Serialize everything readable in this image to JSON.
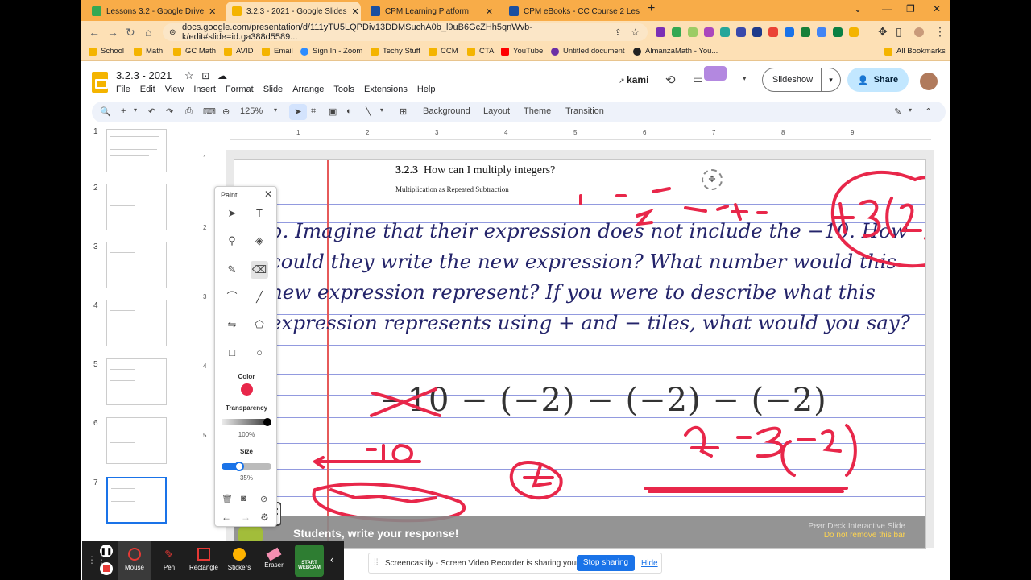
{
  "tabs": [
    {
      "title": "Lessons 3.2 - Google Drive",
      "color": "#34a853",
      "active": false
    },
    {
      "title": "3.2.3 - 2021 - Google Slides",
      "color": "#f4b400",
      "active": true
    },
    {
      "title": "CPM Learning Platform",
      "color": "#1a4fa0",
      "active": false
    },
    {
      "title": "CPM eBooks - CC Course 2 Less",
      "color": "#1a4fa0",
      "active": false
    }
  ],
  "address": "docs.google.com/presentation/d/111yTU5LQPDiv13DDMSuchA0b_l9uB6GcZHh5qnWvb-k/edit#slide=id.ga388d5589...",
  "bookmarks": [
    {
      "label": "School",
      "color": "#f4b400"
    },
    {
      "label": "Math",
      "color": "#f4b400"
    },
    {
      "label": "GC Math",
      "color": "#f4b400"
    },
    {
      "label": "AVID",
      "color": "#f4b400"
    },
    {
      "label": "Email",
      "color": "#f4b400"
    },
    {
      "label": "Sign In - Zoom",
      "color": "#2d8cff"
    },
    {
      "label": "Techy Stuff",
      "color": "#f4b400"
    },
    {
      "label": "CCM",
      "color": "#f4b400"
    },
    {
      "label": "CTA",
      "color": "#f4b400"
    },
    {
      "label": "YouTube",
      "color": "#ff0000"
    },
    {
      "label": "Untitled document",
      "color": "#6b2fa5"
    },
    {
      "label": "AlmanzaMath - You...",
      "color": "#222222"
    }
  ],
  "all_bookmarks": "All Bookmarks",
  "doc": {
    "title": "3.2.3 - 2021",
    "menu": [
      "File",
      "Edit",
      "View",
      "Insert",
      "Format",
      "Slide",
      "Arrange",
      "Tools",
      "Extensions",
      "Help"
    ],
    "kami": "kami",
    "slideshow": "Slideshow",
    "share": "Share"
  },
  "toolbar": {
    "zoom": "125%",
    "background": "Background",
    "layout": "Layout",
    "theme": "Theme",
    "transition": "Transition"
  },
  "ruler": [
    "1",
    "2",
    "3",
    "4",
    "5",
    "6",
    "7",
    "8",
    "9"
  ],
  "vruler": [
    "1",
    "2",
    "3",
    "4",
    "5"
  ],
  "thumbnails": [
    "1",
    "2",
    "3",
    "4",
    "5",
    "6",
    "7"
  ],
  "slide": {
    "heading_num": "3.2.3",
    "heading": "How can I multiply integers?",
    "subheading": "Multiplication as Repeated Subtraction",
    "question": "b.   Imagine that their expression does not include the −10.  How could they write the new expression?  What number would this new expression represent?  If you were to describe what this expression represents using + and − tiles, what would you say?",
    "expression": "−10 − (−2) − (−2) − (−2)",
    "peardeck_prompt": "Students, write your response!",
    "peardeck_note1": "Pear Deck Interactive Slide",
    "peardeck_note2": "Do not remove this bar"
  },
  "paint": {
    "title": "Paint",
    "color_label": "Color",
    "color": "#e8274a",
    "transparency_label": "Transparency",
    "transparency": "100%",
    "size_label": "Size",
    "size": "35%"
  },
  "recorder": [
    {
      "label": "Mouse"
    },
    {
      "label": "Pen"
    },
    {
      "label": "Rectangle"
    },
    {
      "label": "Stickers"
    },
    {
      "label": "Eraser"
    },
    {
      "label": "START WEBCAM"
    }
  ],
  "sharebar": {
    "message": "Screencastify - Screen Video Recorder is sharing your screen.",
    "stop": "Stop sharing",
    "hide": "Hide"
  }
}
